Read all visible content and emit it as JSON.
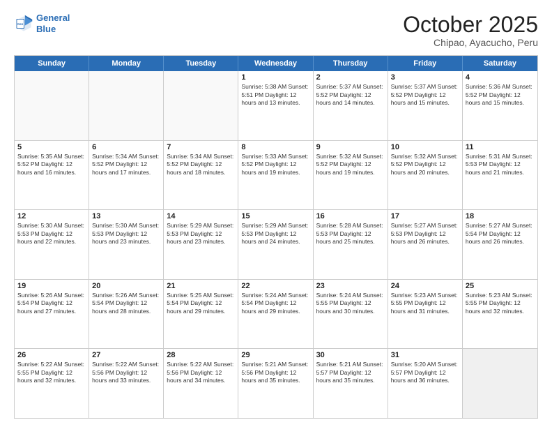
{
  "logo": {
    "line1": "General",
    "line2": "Blue"
  },
  "title": "October 2025",
  "subtitle": "Chipao, Ayacucho, Peru",
  "header_days": [
    "Sunday",
    "Monday",
    "Tuesday",
    "Wednesday",
    "Thursday",
    "Friday",
    "Saturday"
  ],
  "rows": [
    [
      {
        "day": "",
        "text": "",
        "empty": true
      },
      {
        "day": "",
        "text": "",
        "empty": true
      },
      {
        "day": "",
        "text": "",
        "empty": true
      },
      {
        "day": "1",
        "text": "Sunrise: 5:38 AM\nSunset: 5:51 PM\nDaylight: 12 hours\nand 13 minutes.",
        "empty": false
      },
      {
        "day": "2",
        "text": "Sunrise: 5:37 AM\nSunset: 5:52 PM\nDaylight: 12 hours\nand 14 minutes.",
        "empty": false
      },
      {
        "day": "3",
        "text": "Sunrise: 5:37 AM\nSunset: 5:52 PM\nDaylight: 12 hours\nand 15 minutes.",
        "empty": false
      },
      {
        "day": "4",
        "text": "Sunrise: 5:36 AM\nSunset: 5:52 PM\nDaylight: 12 hours\nand 15 minutes.",
        "empty": false
      }
    ],
    [
      {
        "day": "5",
        "text": "Sunrise: 5:35 AM\nSunset: 5:52 PM\nDaylight: 12 hours\nand 16 minutes.",
        "empty": false
      },
      {
        "day": "6",
        "text": "Sunrise: 5:34 AM\nSunset: 5:52 PM\nDaylight: 12 hours\nand 17 minutes.",
        "empty": false
      },
      {
        "day": "7",
        "text": "Sunrise: 5:34 AM\nSunset: 5:52 PM\nDaylight: 12 hours\nand 18 minutes.",
        "empty": false
      },
      {
        "day": "8",
        "text": "Sunrise: 5:33 AM\nSunset: 5:52 PM\nDaylight: 12 hours\nand 19 minutes.",
        "empty": false
      },
      {
        "day": "9",
        "text": "Sunrise: 5:32 AM\nSunset: 5:52 PM\nDaylight: 12 hours\nand 19 minutes.",
        "empty": false
      },
      {
        "day": "10",
        "text": "Sunrise: 5:32 AM\nSunset: 5:52 PM\nDaylight: 12 hours\nand 20 minutes.",
        "empty": false
      },
      {
        "day": "11",
        "text": "Sunrise: 5:31 AM\nSunset: 5:53 PM\nDaylight: 12 hours\nand 21 minutes.",
        "empty": false
      }
    ],
    [
      {
        "day": "12",
        "text": "Sunrise: 5:30 AM\nSunset: 5:53 PM\nDaylight: 12 hours\nand 22 minutes.",
        "empty": false
      },
      {
        "day": "13",
        "text": "Sunrise: 5:30 AM\nSunset: 5:53 PM\nDaylight: 12 hours\nand 23 minutes.",
        "empty": false
      },
      {
        "day": "14",
        "text": "Sunrise: 5:29 AM\nSunset: 5:53 PM\nDaylight: 12 hours\nand 23 minutes.",
        "empty": false
      },
      {
        "day": "15",
        "text": "Sunrise: 5:29 AM\nSunset: 5:53 PM\nDaylight: 12 hours\nand 24 minutes.",
        "empty": false
      },
      {
        "day": "16",
        "text": "Sunrise: 5:28 AM\nSunset: 5:53 PM\nDaylight: 12 hours\nand 25 minutes.",
        "empty": false
      },
      {
        "day": "17",
        "text": "Sunrise: 5:27 AM\nSunset: 5:53 PM\nDaylight: 12 hours\nand 26 minutes.",
        "empty": false
      },
      {
        "day": "18",
        "text": "Sunrise: 5:27 AM\nSunset: 5:54 PM\nDaylight: 12 hours\nand 26 minutes.",
        "empty": false
      }
    ],
    [
      {
        "day": "19",
        "text": "Sunrise: 5:26 AM\nSunset: 5:54 PM\nDaylight: 12 hours\nand 27 minutes.",
        "empty": false
      },
      {
        "day": "20",
        "text": "Sunrise: 5:26 AM\nSunset: 5:54 PM\nDaylight: 12 hours\nand 28 minutes.",
        "empty": false
      },
      {
        "day": "21",
        "text": "Sunrise: 5:25 AM\nSunset: 5:54 PM\nDaylight: 12 hours\nand 29 minutes.",
        "empty": false
      },
      {
        "day": "22",
        "text": "Sunrise: 5:24 AM\nSunset: 5:54 PM\nDaylight: 12 hours\nand 29 minutes.",
        "empty": false
      },
      {
        "day": "23",
        "text": "Sunrise: 5:24 AM\nSunset: 5:55 PM\nDaylight: 12 hours\nand 30 minutes.",
        "empty": false
      },
      {
        "day": "24",
        "text": "Sunrise: 5:23 AM\nSunset: 5:55 PM\nDaylight: 12 hours\nand 31 minutes.",
        "empty": false
      },
      {
        "day": "25",
        "text": "Sunrise: 5:23 AM\nSunset: 5:55 PM\nDaylight: 12 hours\nand 32 minutes.",
        "empty": false
      }
    ],
    [
      {
        "day": "26",
        "text": "Sunrise: 5:22 AM\nSunset: 5:55 PM\nDaylight: 12 hours\nand 32 minutes.",
        "empty": false
      },
      {
        "day": "27",
        "text": "Sunrise: 5:22 AM\nSunset: 5:56 PM\nDaylight: 12 hours\nand 33 minutes.",
        "empty": false
      },
      {
        "day": "28",
        "text": "Sunrise: 5:22 AM\nSunset: 5:56 PM\nDaylight: 12 hours\nand 34 minutes.",
        "empty": false
      },
      {
        "day": "29",
        "text": "Sunrise: 5:21 AM\nSunset: 5:56 PM\nDaylight: 12 hours\nand 35 minutes.",
        "empty": false
      },
      {
        "day": "30",
        "text": "Sunrise: 5:21 AM\nSunset: 5:57 PM\nDaylight: 12 hours\nand 35 minutes.",
        "empty": false
      },
      {
        "day": "31",
        "text": "Sunrise: 5:20 AM\nSunset: 5:57 PM\nDaylight: 12 hours\nand 36 minutes.",
        "empty": false
      },
      {
        "day": "",
        "text": "",
        "empty": true,
        "shaded": true
      }
    ]
  ]
}
